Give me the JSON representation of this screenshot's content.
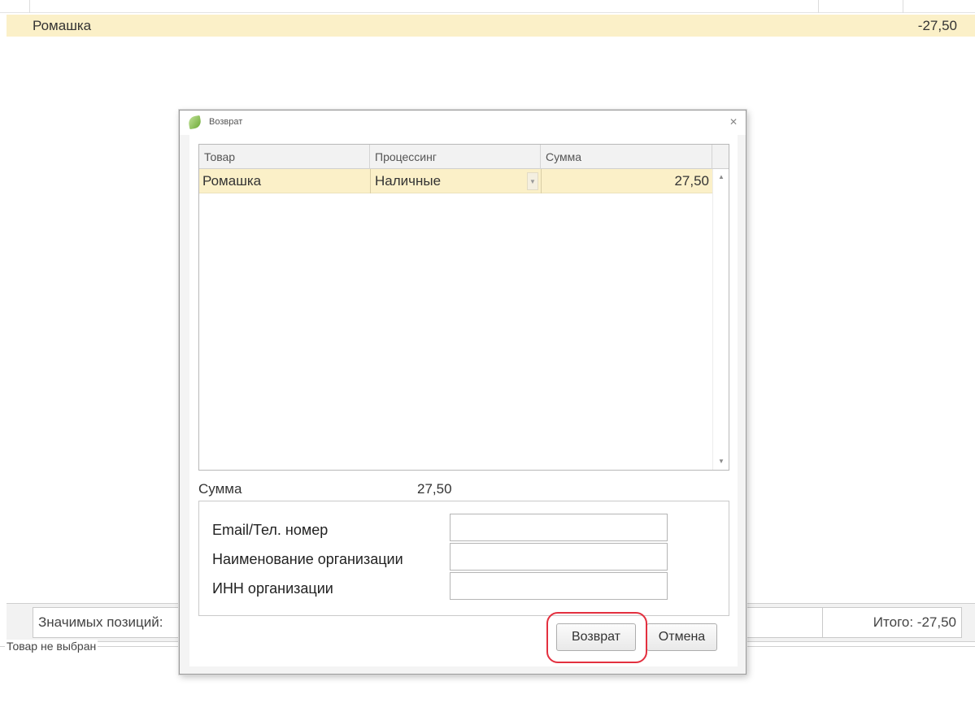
{
  "background": {
    "row": {
      "name": "Ромашка",
      "amount": "-27,50"
    },
    "status": {
      "positions_label": "Значимых позиций:",
      "total_label": "Итого: -27,50"
    },
    "selection_group_label": "Товар не выбран"
  },
  "dialog": {
    "title": "Возврат",
    "grid": {
      "columns": [
        "Товар",
        "Процессинг",
        "Сумма"
      ],
      "rows": [
        {
          "product": "Ромашка",
          "processing": "Наличные",
          "amount": "27,50"
        }
      ]
    },
    "sum": {
      "label": "Сумма",
      "value": "27,50"
    },
    "fields": [
      {
        "label": "Email/Тел. номер",
        "value": ""
      },
      {
        "label": "Наименование организации",
        "value": ""
      },
      {
        "label": "ИНН организации",
        "value": ""
      }
    ],
    "buttons": {
      "return": "Возврат",
      "cancel": "Отмена"
    }
  },
  "colors": {
    "selected_row": "#fbf0c8",
    "highlight_ring": "#e3303f"
  },
  "icons": {
    "app": "leaf-icon",
    "close": "close-icon",
    "dropdown": "chevron-down-icon",
    "scroll_up": "triangle-up-icon",
    "scroll_down": "triangle-down-icon"
  }
}
